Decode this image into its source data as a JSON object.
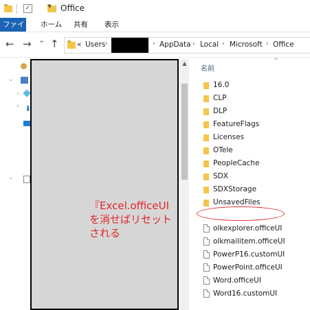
{
  "window": {
    "title": "Office"
  },
  "quick_access": {
    "arrow_glyph": "▾"
  },
  "ribbon": {
    "tabs": [
      {
        "label": "ファイル",
        "active": true
      },
      {
        "label": "ホーム"
      },
      {
        "label": "共有"
      },
      {
        "label": "表示"
      }
    ],
    "accent_color": "#1a63b5"
  },
  "nav": {
    "back": "←",
    "forward": "→",
    "recent": "⌄",
    "up": "↑"
  },
  "address": {
    "prefix": "«",
    "crumbs": [
      "Users",
      "AppData",
      "Local",
      "Microsoft",
      "Office"
    ],
    "separator": "›"
  },
  "filelist": {
    "header": "名前",
    "sort_glyph": "^",
    "folders": [
      "16.0",
      "CLP",
      "DLP",
      "FeatureFlags",
      "Licenses",
      "OTele",
      "PeopleCache",
      "SDX",
      "SDXStorage",
      "UnsavedFiles"
    ],
    "files": [
      "olkexplorer.officeUI",
      "olkmailitem.officeUI",
      "PowerP16.customUI",
      "PowerPoint.officeUI",
      "Word.officeUI",
      "Word16.customUI"
    ]
  },
  "annotation": {
    "line1": "『Excel.officeUI",
    "line2": "を消せばリセット",
    "line3": "される",
    "color": "#e2262b"
  },
  "scrollbar": {
    "up_glyph": "▲"
  }
}
